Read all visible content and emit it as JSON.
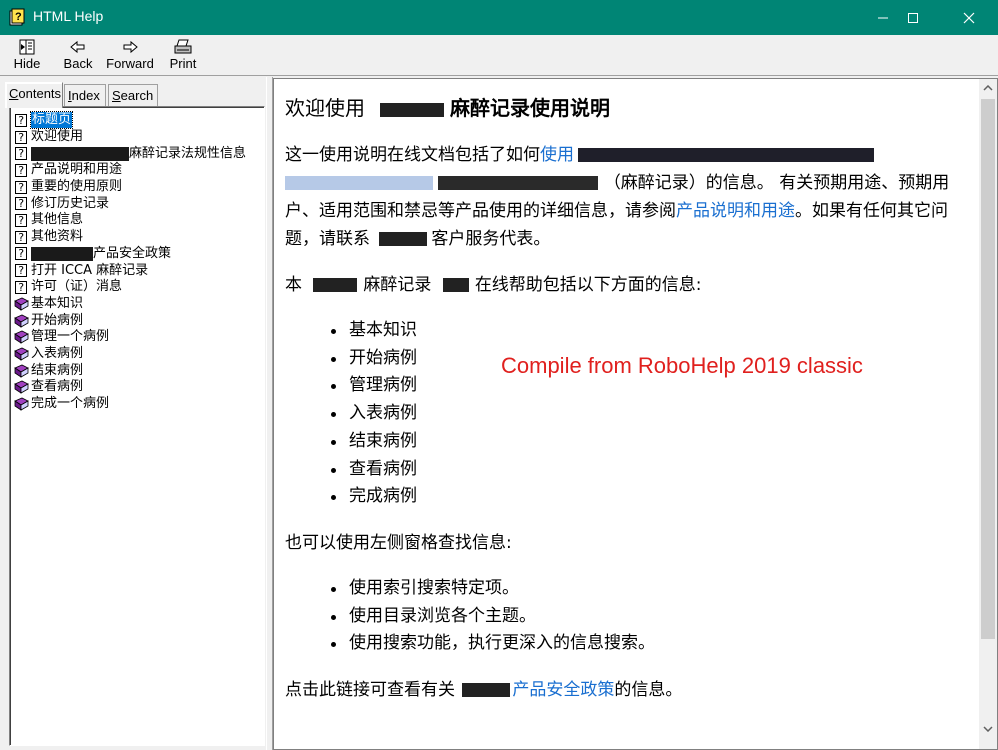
{
  "window": {
    "title": "HTML Help"
  },
  "toolbar": {
    "hide_label": "Hide",
    "back_label": "Back",
    "forward_label": "Forward",
    "print_label": "Print"
  },
  "tabs": {
    "contents": {
      "u": "C",
      "rest": "ontents"
    },
    "index": {
      "u": "I",
      "rest": "ndex"
    },
    "search": {
      "u": "S",
      "rest": "earch"
    }
  },
  "tree": {
    "items": [
      {
        "label": "标题页",
        "icon": "page-icon",
        "selected": true
      },
      {
        "label": "欢迎使用",
        "icon": "page-icon"
      },
      {
        "label": "麻醉记录法规性信息",
        "icon": "page-icon",
        "redacted_prefix": true
      },
      {
        "label": "产品说明和用途",
        "icon": "page-icon"
      },
      {
        "label": "重要的使用原则",
        "icon": "page-icon"
      },
      {
        "label": "修订历史记录",
        "icon": "page-icon"
      },
      {
        "label": "其他信息",
        "icon": "page-icon"
      },
      {
        "label": "其他资料",
        "icon": "page-icon"
      },
      {
        "label": "产品安全政策",
        "icon": "page-icon",
        "redacted_prefix": true
      },
      {
        "label": "打开 ICCA 麻醉记录",
        "icon": "page-icon"
      },
      {
        "label": "许可（证）消息",
        "icon": "page-icon"
      },
      {
        "label": "基本知识",
        "icon": "book-icon"
      },
      {
        "label": "开始病例",
        "icon": "book-icon"
      },
      {
        "label": "管理一个病例",
        "icon": "book-icon"
      },
      {
        "label": "入表病例",
        "icon": "book-icon"
      },
      {
        "label": "结束病例",
        "icon": "book-icon"
      },
      {
        "label": "查看病例",
        "icon": "book-icon"
      },
      {
        "label": "完成一个病例",
        "icon": "book-icon"
      }
    ]
  },
  "content": {
    "heading_pre": "欢迎使用",
    "heading_main": "麻醉记录使用说明",
    "p1_a": "这一使用说明在线文档包括了如何",
    "p1_link": "使用",
    "p1_b": "（麻醉记录）的信息。 有关预期用途、预期用户、适用范围和禁忌等产品使用的详细信息，请参阅",
    "p1_link2": "产品说明和用途",
    "p1_c": "。如果有任何其它问题，请联系",
    "p1_d": "客户服务代表。",
    "p2_a": "本",
    "p2_b": "麻醉记录",
    "p2_c": "在线帮助包括以下方面的信息:",
    "list1": [
      "基本知识",
      "开始病例",
      "管理病例",
      "入表病例",
      "结束病例",
      "查看病例",
      "完成病例"
    ],
    "p3": "也可以使用左侧窗格查找信息:",
    "list2": [
      "使用索引搜索特定项。",
      "使用目录浏览各个主题。",
      "使用搜索功能，执行更深入的信息搜索。"
    ],
    "p4_a": "点击此链接可查看有关",
    "p4_link": "产品安全政策",
    "p4_b": "的信息。",
    "watermark": "Compile from RoboHelp 2019 classic"
  },
  "colors": {
    "titlebar": "#008575",
    "link": "#1a6fd0",
    "watermark": "#e0201e",
    "selection": "#0078d7"
  }
}
